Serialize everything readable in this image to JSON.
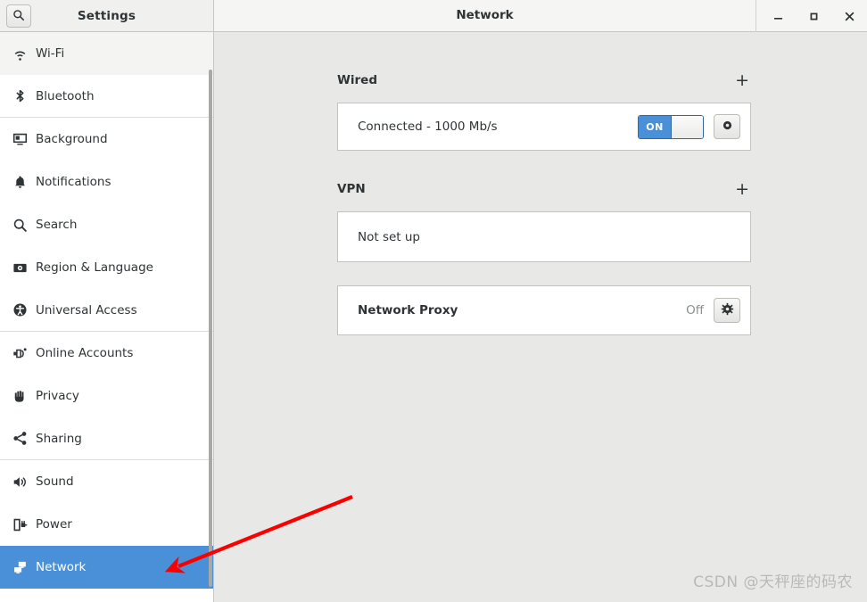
{
  "window": {
    "sidebar_title": "Settings",
    "content_title": "Network",
    "search_icon": "search-icon",
    "controls": {
      "minimize": "minimize-icon",
      "maximize": "maximize-icon",
      "close": "close-icon"
    }
  },
  "sidebar": {
    "items": [
      {
        "label": "Wi-Fi",
        "icon": "wifi-icon",
        "state": "hover"
      },
      {
        "label": "Bluetooth",
        "icon": "bluetooth-icon",
        "state": "normal"
      },
      {
        "label": "Background",
        "icon": "background-icon",
        "state": "normal"
      },
      {
        "label": "Notifications",
        "icon": "bell-icon",
        "state": "normal"
      },
      {
        "label": "Search",
        "icon": "search-icon",
        "state": "normal"
      },
      {
        "label": "Region & Language",
        "icon": "region-language-icon",
        "state": "normal"
      },
      {
        "label": "Universal Access",
        "icon": "accessibility-icon",
        "state": "normal"
      },
      {
        "label": "Online Accounts",
        "icon": "online-accounts-icon",
        "state": "normal"
      },
      {
        "label": "Privacy",
        "icon": "hand-icon",
        "state": "normal"
      },
      {
        "label": "Sharing",
        "icon": "share-icon",
        "state": "normal"
      },
      {
        "label": "Sound",
        "icon": "speaker-icon",
        "state": "normal"
      },
      {
        "label": "Power",
        "icon": "power-plug-icon",
        "state": "normal"
      },
      {
        "label": "Network",
        "icon": "network-icon",
        "state": "selected"
      }
    ]
  },
  "main": {
    "wired": {
      "heading": "Wired",
      "add_label": "+",
      "status": "Connected - 1000 Mb/s",
      "toggle_label": "ON",
      "toggle_on": true,
      "settings_icon": "gear-icon"
    },
    "vpn": {
      "heading": "VPN",
      "add_label": "+",
      "status": "Not set up"
    },
    "proxy": {
      "title": "Network Proxy",
      "status": "Off",
      "settings_icon": "gear-icon"
    }
  },
  "annotation": {
    "arrow_color": "#ff0000",
    "watermark": "CSDN @天秤座的码农"
  },
  "colors": {
    "accent": "#4a90d9",
    "panel_bg": "#e8e8e7",
    "card_bg": "#ffffff",
    "text": "#2e3436",
    "muted": "#8b8e8f"
  }
}
